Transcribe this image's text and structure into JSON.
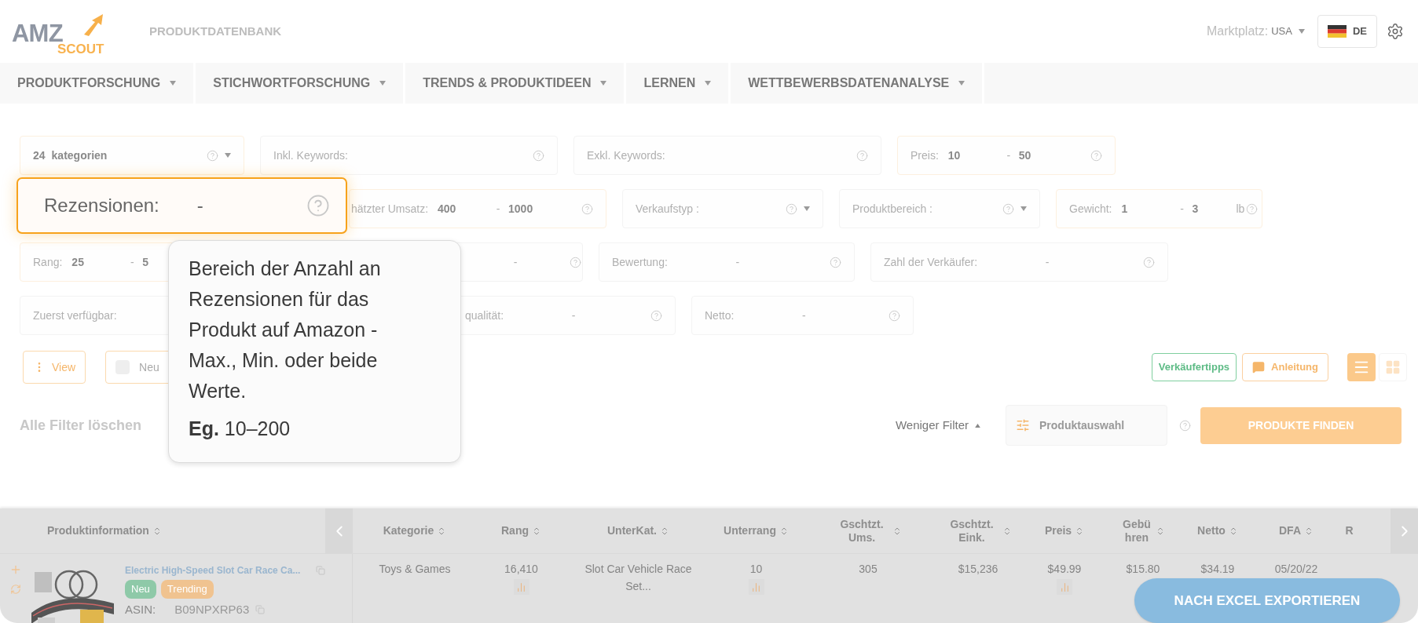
{
  "logo": {
    "word": "AMZ",
    "sub": "SCOUT"
  },
  "page_title": "PRODUKTDATENBANK",
  "marketplace": {
    "label": "Marktplatz:",
    "value": "USA"
  },
  "language": "DE",
  "nav": [
    {
      "label": "PRODUKTFORSCHUNG"
    },
    {
      "label": "STICHWORTFORSCHUNG"
    },
    {
      "label": "TRENDS & PRODUKTIDEEN"
    },
    {
      "label": "LERNEN"
    },
    {
      "label": "WETTBEWERBSDATENANALYSE"
    }
  ],
  "filter_rows": [
    [
      {
        "kind": "category",
        "count": "24",
        "label": "kategorien",
        "active": true
      },
      {
        "kind": "keyword",
        "label": "Inkl. Keywords:",
        "active": false
      },
      {
        "kind": "keyword",
        "label": "Exkl. Keywords:",
        "active": false
      },
      {
        "kind": "range",
        "label": "Preis:",
        "min": "10",
        "dash": "-",
        "max": "50",
        "active": true
      }
    ],
    [
      {
        "kind": "range",
        "label": "hätzter Umsatz:",
        "min": "400",
        "dash": "-",
        "max": "1000",
        "active": true
      },
      {
        "kind": "dropdown",
        "label": "Verkaufstyp :",
        "active": false
      },
      {
        "kind": "dropdown",
        "label": "Produktbereich :",
        "active": false
      },
      {
        "kind": "range",
        "label": "Gewicht:",
        "min": "1",
        "dash": "-",
        "max": "3",
        "unit": "lb",
        "active": true
      }
    ],
    [
      {
        "kind": "range",
        "label": "Rang:",
        "min": "25",
        "dash": "-",
        "max": "5",
        "active": true
      },
      {
        "kind": "range",
        "dash": "-",
        "active": false
      },
      {
        "kind": "range",
        "label": "Bewertung:",
        "dash": "-",
        "active": false
      },
      {
        "kind": "range",
        "label": "Zahl der Verkäufer:",
        "dash": "-",
        "active": false
      }
    ],
    [
      {
        "kind": "range",
        "label": "Zuerst verfügbar:",
        "active": false
      },
      {
        "kind": "range",
        "label": "qualität:",
        "dash": "-",
        "active": false
      },
      {
        "kind": "range",
        "label": "Netto:",
        "dash": "-",
        "active": false
      }
    ]
  ],
  "spotlight": {
    "label": "Rezensionen:",
    "dash": "-"
  },
  "tooltip": {
    "text": "Bereich der Anzahl an Rezensionen für das Produkt auf Amazon - Max., Min. oder beide Werte.",
    "example": "**Eg.** 10–200"
  },
  "toolbar": {
    "view": "View",
    "new_filter": {
      "label": "Neu",
      "checked": false
    },
    "tips": "Verkäufertipps",
    "guide": "Anleitung",
    "views": [
      {
        "kind": "list",
        "selected": true
      },
      {
        "kind": "grid",
        "selected": false
      }
    ]
  },
  "actions": {
    "clear": "Alle Filter löschen",
    "less": "Weniger Filter",
    "selection": "Produktauswahl",
    "find": "PRODUKTE FINDEN"
  },
  "table": {
    "product_column": "Produktinformation",
    "columns": [
      "Kategorie",
      "Rang",
      "UnterKat.",
      "Unterrang",
      "Gschtzt. Ums.",
      "Gschtzt. Eink.",
      "Preis",
      "Gebühren",
      "Netto",
      "DFA",
      "R"
    ],
    "rows": [
      {
        "title": "Electric High-Speed Slot Car Race Ca...",
        "badges": [
          {
            "label": "Neu",
            "color": "#8ec9a8"
          },
          {
            "label": "Trending",
            "color": "#f0c390"
          }
        ],
        "asin_label": "ASIN:",
        "asin": "B09NPXRP63",
        "cells": [
          {
            "text": "Toys & Games",
            "chart": false
          },
          {
            "text": "16,410",
            "chart": true
          },
          {
            "text": "Slot Car Vehicle Race Set...",
            "chart": false
          },
          {
            "text": "10",
            "chart": true
          },
          {
            "text": "305",
            "chart": false
          },
          {
            "text": "$15,236",
            "chart": false
          },
          {
            "text": "$49.99",
            "chart": true
          },
          {
            "text": "$15.80",
            "chart": false
          },
          {
            "text": "$34.19",
            "chart": false
          },
          {
            "text": "05/20/22",
            "chart": false
          }
        ]
      }
    ]
  },
  "export": "NACH EXCEL EXPORTIEREN"
}
